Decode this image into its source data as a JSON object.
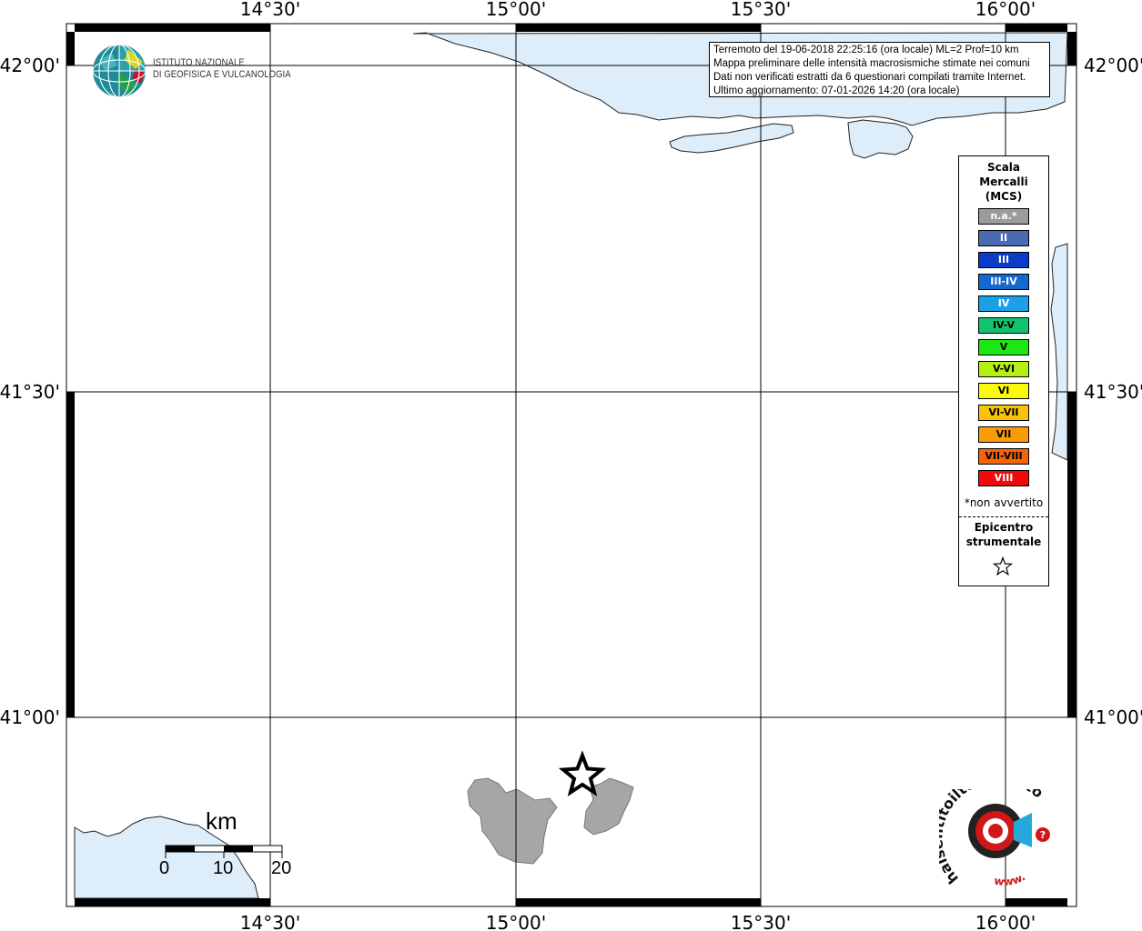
{
  "info_box": {
    "line1": "Terremoto del 19-06-2018 22:25:16 (ora locale) ML=2 Prof=10 km",
    "line2": "Mappa preliminare delle intensità macrosismiche stimate nei comuni",
    "line3": "Dati non verificati estratti da 6 questionari compilati tramite Internet.",
    "line4": "Ultimo aggiornamento: 07-01-2026 14:20 (ora locale)"
  },
  "coords": {
    "lon_1430": "14°30'",
    "lon_1500": "15°00'",
    "lon_1530": "15°30'",
    "lon_1600": "16°00'",
    "lat_4200": "42°00'",
    "lat_4130": "41°30'",
    "lat_4100": "41°00'"
  },
  "logo": {
    "line1": "ISTITUTO NAZIONALE",
    "line2": "DI GEOFISICA E VULCANOLOGIA"
  },
  "legend": {
    "title_line1": "Scala",
    "title_line2": "Mercalli",
    "title_line3": "(MCS)",
    "items": [
      {
        "label": "n.a.*",
        "color": "#9b9b9b",
        "text_color": "#ffffff"
      },
      {
        "label": "II",
        "color": "#4a6ab3",
        "text_color": "#ffffff"
      },
      {
        "label": "III",
        "color": "#0a3cc8",
        "text_color": "#ffffff"
      },
      {
        "label": "III-IV",
        "color": "#1468d2",
        "text_color": "#ffffff"
      },
      {
        "label": "IV",
        "color": "#1aa0e6",
        "text_color": "#ffffff"
      },
      {
        "label": "IV-V",
        "color": "#12c36e",
        "text_color": "#000000"
      },
      {
        "label": "V",
        "color": "#1ee614",
        "text_color": "#000000"
      },
      {
        "label": "V-VI",
        "color": "#b4f014",
        "text_color": "#000000"
      },
      {
        "label": "VI",
        "color": "#fafa0a",
        "text_color": "#000000"
      },
      {
        "label": "VI-VII",
        "color": "#fac30a",
        "text_color": "#000000"
      },
      {
        "label": "VII",
        "color": "#fa9b0a",
        "text_color": "#000000"
      },
      {
        "label": "VII-VIII",
        "color": "#f5640a",
        "text_color": "#000000"
      },
      {
        "label": "VIII",
        "color": "#f00a0a",
        "text_color": "#ffffff"
      }
    ],
    "note": "*non avvertito",
    "epicenter_line1": "Epicentro",
    "epicenter_line2": "strumentale"
  },
  "scalebar": {
    "unit": "km",
    "labels": [
      "0",
      "10",
      "20"
    ]
  },
  "hsit_logo": {
    "text": "haisentitoilterremoto.it",
    "www": "www."
  },
  "colors": {
    "sea": "#ddeefa",
    "municipality": "#a6a6a6",
    "grid": "#000000"
  }
}
